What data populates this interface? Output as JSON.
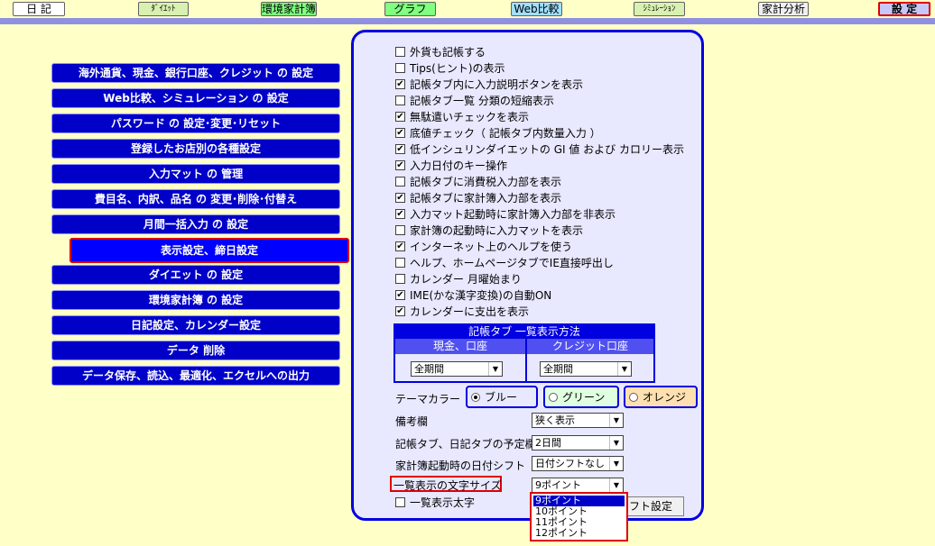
{
  "tabs": [
    {
      "label": "日 記",
      "bg": "#ffffff"
    },
    {
      "label": "ﾀﾞｲｴｯﾄ",
      "bg": "#d8f0b0"
    },
    {
      "label": "環境家計簿",
      "bg": "#80ff80"
    },
    {
      "label": "グラフ",
      "bg": "#80ff80"
    },
    {
      "label": "Web比較",
      "bg": "#a0e0ff"
    },
    {
      "label": "ｼﾐｭﾚｰｼｮﾝ",
      "bg": "#d8f0b0"
    },
    {
      "label": "家計分析",
      "bg": "#f0f0f0"
    },
    {
      "label": "設 定",
      "bg": "#c8c8f8"
    }
  ],
  "menu": [
    "海外通貨、現金、銀行口座、クレジット の 設定",
    "Web比較、シミュレーション の 設定",
    "パスワード の 設定･変更･リセット",
    "登録したお店別の各種設定",
    "入力マット の 管理",
    "費目名、内訳、品名 の 変更･削除･付替え",
    "月間一括入力 の 設定",
    "表示設定、締日設定",
    "ダイエット の 設定",
    "環境家計簿 の 設定",
    "日記設定、カレンダー設定",
    "データ 削除",
    "データ保存、読込、最適化、エクセルへの出力"
  ],
  "checkboxes": [
    {
      "label": "外貨も記帳する",
      "checked": false
    },
    {
      "label": "Tips(ヒント)の表示",
      "checked": false
    },
    {
      "label": "記帳タブ内に入力説明ボタンを表示",
      "checked": true
    },
    {
      "label": "記帳タブ一覧 分類の短縮表示",
      "checked": false
    },
    {
      "label": "無駄遣いチェックを表示",
      "checked": true
    },
    {
      "label": "底値チェック（ 記帳タブ内数量入力 ）",
      "checked": true
    },
    {
      "label": "低インシュリンダイエットの GI 値  および カロリー表示",
      "checked": true
    },
    {
      "label": "入力日付のキー操作",
      "checked": true
    },
    {
      "label": "記帳タブに消費税入力部を表示",
      "checked": false
    },
    {
      "label": "記帳タブに家計簿入力部を表示",
      "checked": true
    },
    {
      "label": "入力マット起動時に家計簿入力部を非表示",
      "checked": true
    },
    {
      "label": "家計簿の起動時に入力マットを表示",
      "checked": false
    },
    {
      "label": "インターネット上のヘルプを使う",
      "checked": true
    },
    {
      "label": "ヘルプ、ホームページタブでIE直接呼出し",
      "checked": false
    },
    {
      "label": "カレンダー 月曜始まり",
      "checked": false
    },
    {
      "label": "IME(かな漢字変換)の自動ON",
      "checked": true
    },
    {
      "label": "カレンダーに支出を表示",
      "checked": true
    }
  ],
  "list_table": {
    "title": "記帳タブ  一覧表示方法",
    "col1_header": "現金、口座",
    "col2_header": "クレジット口座",
    "col1_value": "全期間",
    "col2_value": "全期間"
  },
  "theme": {
    "label": "テーマカラー",
    "options": [
      {
        "label": "ブルー",
        "selected": true,
        "bg": "#e8e8ff"
      },
      {
        "label": "グリーン",
        "selected": false,
        "bg": "#e0ffe0"
      },
      {
        "label": "オレンジ",
        "selected": false,
        "bg": "#ffe0b0"
      }
    ]
  },
  "settings": {
    "memo_label": "備考欄",
    "memo_value": "狭く表示",
    "schedule_label": "記帳タブ、日記タブの予定欄",
    "schedule_value": "2日間",
    "dateshift_label": "家計簿起動時の日付シフト",
    "dateshift_value": "日付シフトなし",
    "fontsize_label": "一覧表示の文字サイズ",
    "fontsize_value": "9ポイント",
    "bold_label": "一覧表示太字",
    "bold_checked": false,
    "font_button": "フト設定"
  },
  "fontsize_options": [
    "9ポイント",
    "10ポイント",
    "11ポイント",
    "12ポイント"
  ],
  "fontsize_selected_index": 0
}
